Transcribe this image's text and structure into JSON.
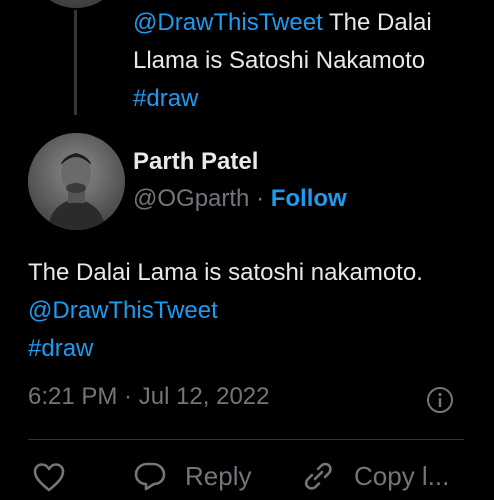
{
  "parent_tweet": {
    "mention": "@DrawThisTweet",
    "text_after_mention": " The Dalai Llama is Satoshi Nakamoto ",
    "hashtag": "#draw"
  },
  "tweet": {
    "author_name": "Parth Patel",
    "handle": "@OGparth",
    "separator": " · ",
    "follow_label": "Follow",
    "text": "The Dalai Lama is satoshi nakamoto. ",
    "mention": "@DrawThisTweet",
    "hashtag": "#draw",
    "time": "6:21 PM",
    "date_separator": " · ",
    "date": "Jul 12, 2022"
  },
  "actions": {
    "reply_label": "Reply",
    "copy_label": "Copy l..."
  },
  "icons": {
    "like": "heart-icon",
    "reply": "reply-icon",
    "copy_link": "link-icon",
    "info": "info-icon"
  },
  "colors": {
    "background": "#000000",
    "text": "#e7e9ea",
    "secondary": "#71767b",
    "link": "#1d9bf0"
  }
}
